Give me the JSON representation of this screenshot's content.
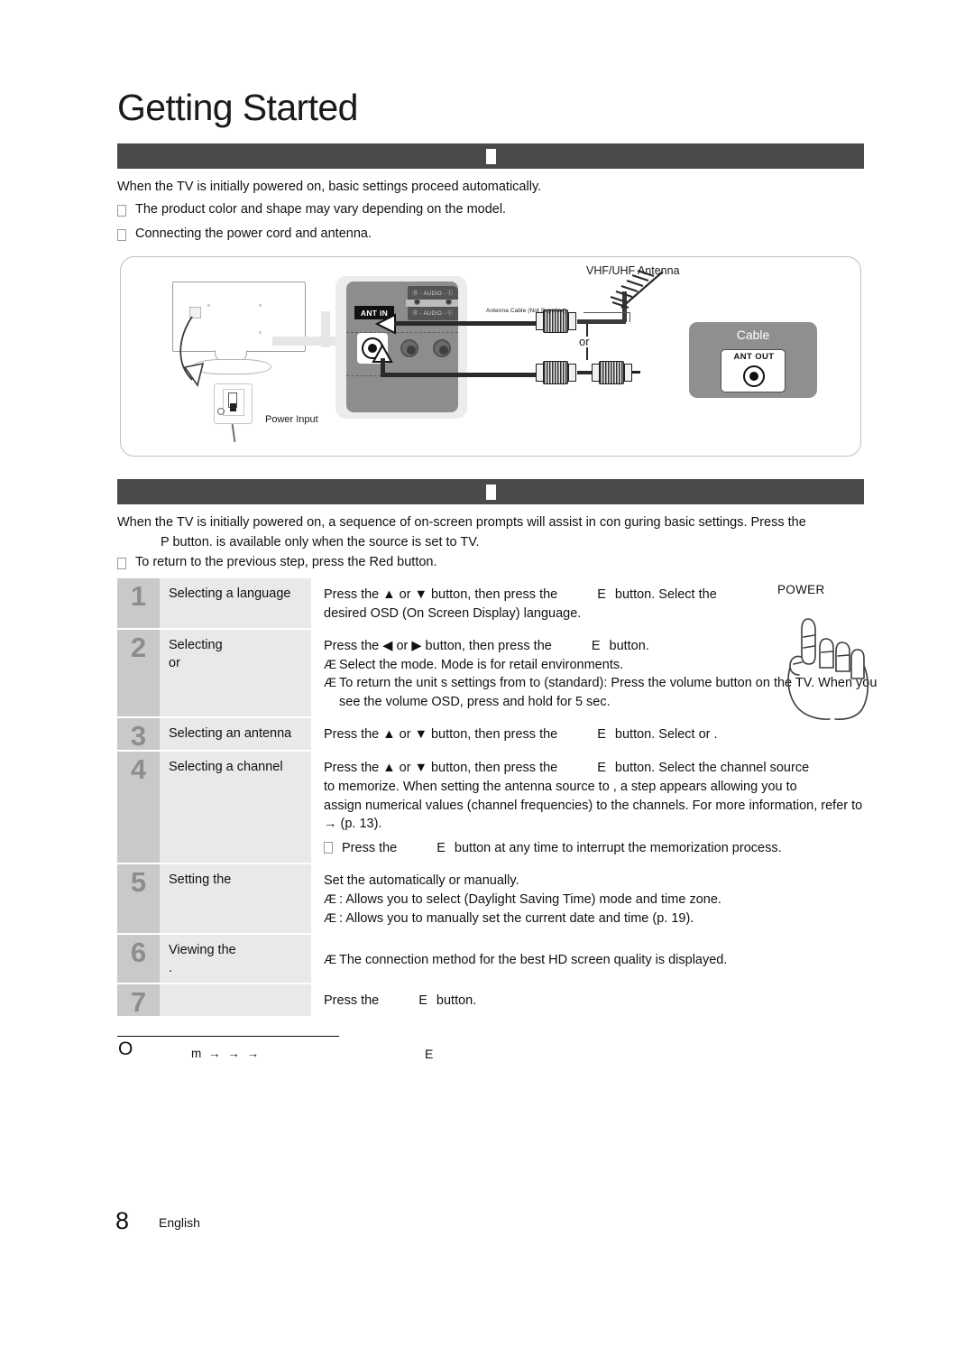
{
  "document": {
    "title": "Getting Started",
    "page_number": "8",
    "language": "English"
  },
  "sections": [
    {
      "id": "initial-setup",
      "bar_glyph": "missing-glyph-box",
      "intro": "When the TV is initially powered on, basic settings proceed automatically.",
      "bullets": [
        "The product color and shape may vary depending on the model.",
        "Connecting the power cord and antenna."
      ]
    },
    {
      "id": "plug-and-play",
      "bar_glyph": "missing-glyph-box",
      "intro_line1": "When the TV is initially powered on, a sequence of on-screen prompts will assist in con guring basic settings. Press the",
      "intro_line2": "P  button.  is available only when the  source is set to TV.",
      "bullets": [
        "To return to the previous step, press the Red button."
      ]
    }
  ],
  "diagram": {
    "labels": {
      "vhf_uhf_antenna": "VHF/UHF Antenna",
      "antenna_cable": "Antenna Cable (Not Supplied)",
      "or": "or",
      "cable": "Cable",
      "ant_out": "ANT OUT",
      "ant_in": "ANT IN",
      "power_input": "Power Input",
      "audio_top": "Ⓡ - AUDIO - Ⓛ",
      "audio_bottom": "Ⓡ - AUDIO - Ⓛ"
    }
  },
  "steps": [
    {
      "number": "1",
      "label": "Selecting a language",
      "body_lines": [
        "Press the ▲ or ▼ button, then press the",
        "desired OSD (On Screen Display) language."
      ],
      "body_token": "E",
      "body_tail": "button. Select the"
    },
    {
      "number": "2",
      "label_line1": "Selecting",
      "label_line2": "or",
      "body_first": "Press the ◀ or ▶ button, then press the",
      "body_token": "E",
      "body_tail": "button.",
      "subs": [
        "Select the  mode.  Mode is for retail environments.",
        "To return the unit s settings from  to  (standard): Press the volume button on the TV. When you see the volume OSD, press and hold  for 5 sec."
      ]
    },
    {
      "number": "3",
      "label": "Selecting an antenna",
      "body_first": "Press the ▲ or ▼ button, then press the",
      "body_token": "E",
      "body_tail": "button. Select  or ."
    },
    {
      "number": "4",
      "label": "Selecting a channel",
      "body_first": "Press the ▲ or ▼ button, then press the",
      "body_token": "E",
      "body_tail": "button. Select the channel source",
      "body_lines": [
        "to memorize. When setting the antenna source to , a step appears allowing you to",
        "assign numerical values (channel frequencies) to the channels. For more information, refer to",
        "→ (p. 13)."
      ],
      "note_pre": "Press the",
      "note_token": "E",
      "note_post": "button at any time to interrupt the memorization process."
    },
    {
      "number": "5",
      "label": "Setting the",
      "body_first": "Set the  automatically or manually.",
      "subs": [
        ": Allows you to select  (Daylight Saving Time) mode and time zone.",
        ": Allows you to manually set the current date and time (p. 19)."
      ]
    },
    {
      "number": "6",
      "label_line1": "Viewing the",
      "label_line2": ".",
      "subs": [
        "The connection method for the best HD screen quality is displayed."
      ]
    },
    {
      "number": "7",
      "label": "",
      "body_pre": "Press the",
      "body_token": "E",
      "body_tail": "button."
    }
  ],
  "side_note": {
    "power_label": "POWER",
    "hand_icon": "pointing-hand-icon"
  },
  "footnote": {
    "marker": "O",
    "sequence": "m  →  →  →",
    "token": "E"
  },
  "colors": {
    "section_bar": "#4a4a4a",
    "step_number_bg": "#c9c9c9",
    "step_label_bg": "#e9e9e9",
    "panel_gray": "#8d8d8d",
    "page_bg": "#ffffff"
  }
}
